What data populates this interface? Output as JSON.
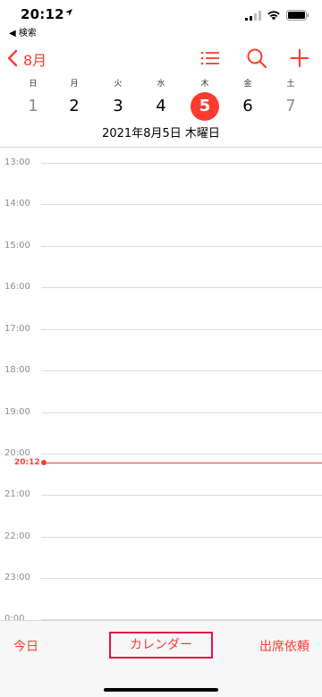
{
  "status_bar": {
    "time": "20:12",
    "back_app": "◀ 検索"
  },
  "nav": {
    "month": "8月"
  },
  "week": {
    "weekdays": [
      "日",
      "月",
      "火",
      "水",
      "木",
      "金",
      "土"
    ],
    "dates": [
      "1",
      "2",
      "3",
      "4",
      "5",
      "6",
      "7"
    ],
    "selected_date": "2021年8月5日 木曜日"
  },
  "timeline": {
    "hours": [
      "13:00",
      "14:00",
      "15:00",
      "16:00",
      "17:00",
      "18:00",
      "19:00",
      "20:00",
      "21:00",
      "22:00",
      "23:00",
      "0:00"
    ],
    "current_time": "20:12"
  },
  "toolbar": {
    "today": "今日",
    "calendars": "カレンダー",
    "inbox": "出席依頼"
  },
  "colors": {
    "accent": "#ff3b30",
    "highlight_border": "#e0144c"
  }
}
